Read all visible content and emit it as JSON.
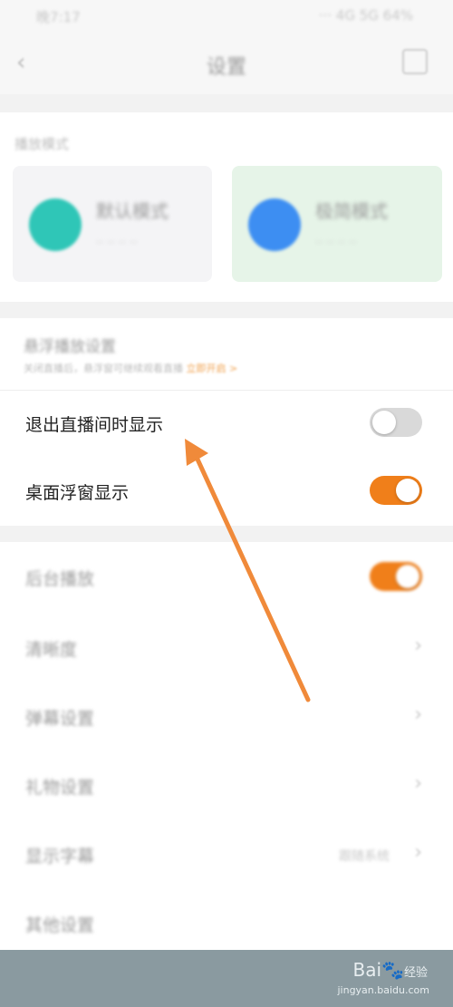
{
  "status_bar": {
    "left": "晚7:17",
    "right": "··· 4G 5G 64%"
  },
  "header": {
    "back_icon": "chevron-left-icon",
    "title": "设置",
    "more_icon": "scan-icon"
  },
  "section": {
    "label": "播放模式"
  },
  "cards": [
    {
      "title": "默认模式",
      "subtitle": "·· ·· ·· ··",
      "color": "#2fc6b7"
    },
    {
      "title": "极简模式",
      "subtitle": "·· ·· ·· ··",
      "color": "#3d8ef2"
    }
  ],
  "floating": {
    "title": "悬浮播放设置",
    "desc": "关闭直播后，悬浮窗可继续观看直播",
    "link": "立即开启 >"
  },
  "rows": {
    "exit_show": {
      "label": "退出直播间时显示",
      "state": "off"
    },
    "desktop_float": {
      "label": "桌面浮窗显示",
      "state": "on"
    },
    "background_play": {
      "label": "后台播放",
      "state": "on"
    },
    "item1": {
      "label": "清晰度"
    },
    "item2": {
      "label": "弹幕设置"
    },
    "item3": {
      "label": "礼物设置"
    },
    "item4": {
      "label": "显示字幕",
      "value": "跟随系统"
    },
    "item5": {
      "label": "其他设置"
    }
  },
  "watermark": {
    "brand": "Bai",
    "suffix": "经验",
    "url": "jingyan.baidu.com"
  },
  "colors": {
    "accent": "#f07f1a",
    "off": "#d9d9d9",
    "arrow": "#f08a3a"
  }
}
